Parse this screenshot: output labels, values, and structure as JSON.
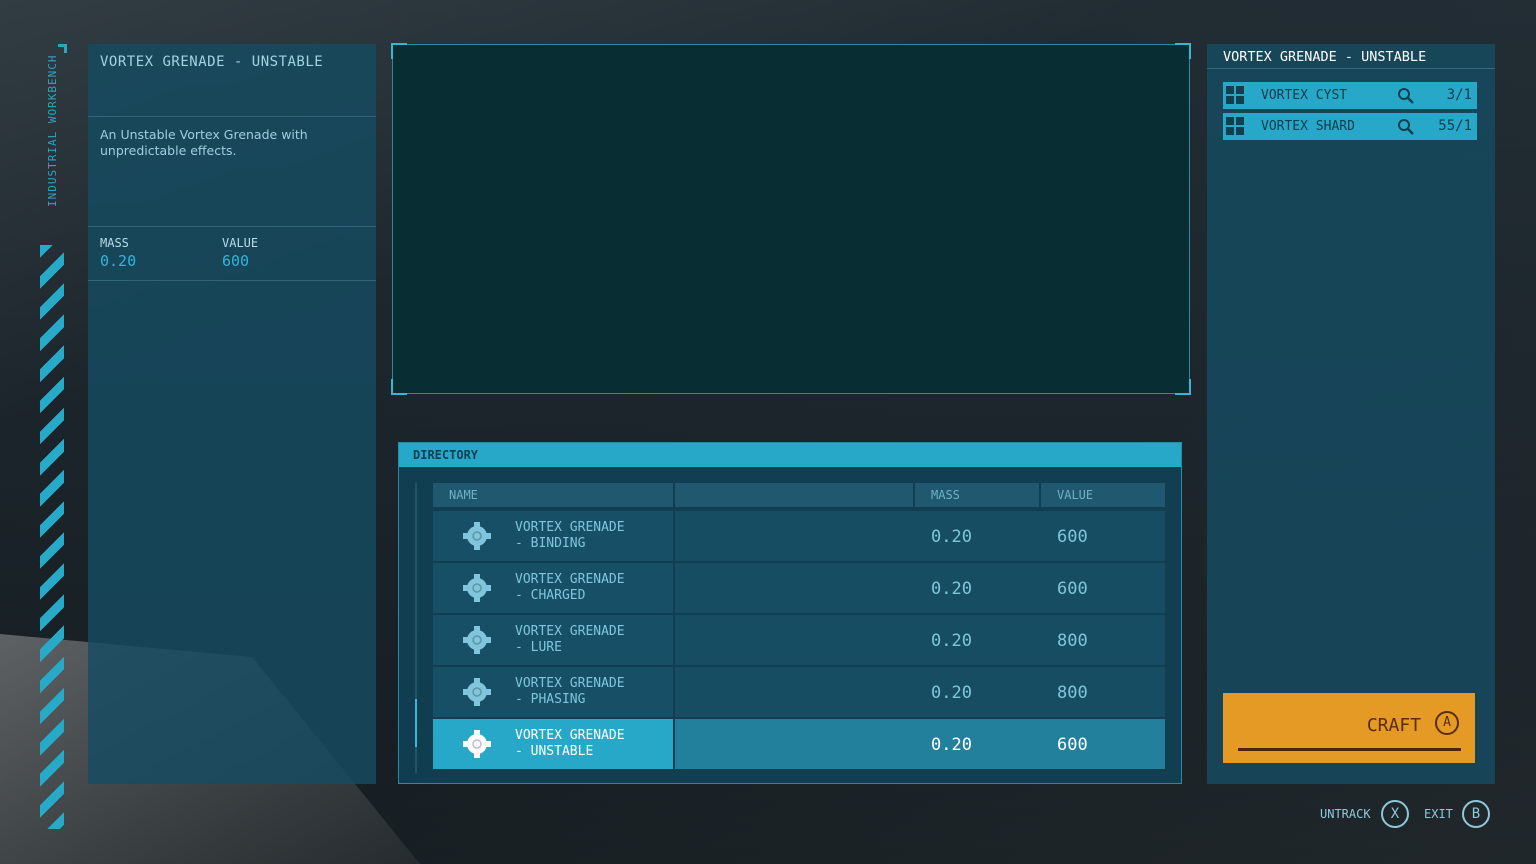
{
  "app": {
    "side_title": "INDUSTRIAL WORKBENCH"
  },
  "item": {
    "title": "VORTEX GRENADE - UNSTABLE",
    "description": "An Unstable Vortex Grenade with unpredictable effects.",
    "mass_label": "MASS",
    "mass": "0.20",
    "value_label": "VALUE",
    "value": "600"
  },
  "directory": {
    "title": "DIRECTORY",
    "columns": {
      "name": "NAME",
      "blank": "",
      "mass": "MASS",
      "value": "VALUE"
    },
    "rows": [
      {
        "name": "VORTEX GRENADE\n- BINDING",
        "mass": "0.20",
        "value": "600",
        "icon": "grenade-icon",
        "selected": false
      },
      {
        "name": "VORTEX GRENADE\n- CHARGED",
        "mass": "0.20",
        "value": "600",
        "icon": "grenade-icon",
        "selected": false
      },
      {
        "name": "VORTEX GRENADE\n- LURE",
        "mass": "0.20",
        "value": "800",
        "icon": "grenade-icon",
        "selected": false
      },
      {
        "name": "VORTEX GRENADE\n- PHASING",
        "mass": "0.20",
        "value": "800",
        "icon": "grenade-icon",
        "selected": false
      },
      {
        "name": "VORTEX GRENADE\n- UNSTABLE",
        "mass": "0.20",
        "value": "600",
        "icon": "grenade-icon",
        "selected": true
      }
    ]
  },
  "requirements": {
    "title": "VORTEX GRENADE - UNSTABLE",
    "resources": [
      {
        "name": "VORTEX CYST",
        "count": "3/1",
        "icon": "resource-grid-icon",
        "search_icon": "search-icon"
      },
      {
        "name": "VORTEX SHARD",
        "count": "55/1",
        "icon": "resource-grid-icon",
        "search_icon": "search-icon"
      }
    ]
  },
  "actions": {
    "craft_label": "CRAFT",
    "craft_key": "A",
    "untrack_label": "UNTRACK",
    "untrack_key": "X",
    "exit_label": "EXIT",
    "exit_key": "B"
  },
  "colors": {
    "accent": "#28a8c9",
    "panel": "#164c62",
    "craft": "#e59a25"
  }
}
